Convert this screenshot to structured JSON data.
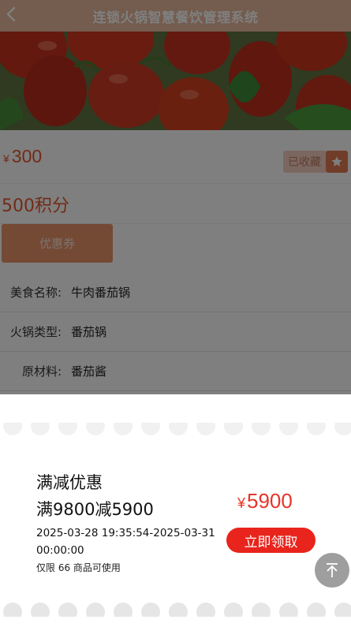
{
  "header": {
    "title": "连锁火锅智慧餐饮管理系统"
  },
  "product": {
    "currency": "¥",
    "price": "300",
    "favorite_label": "已收藏",
    "points": "500积分",
    "coupon_button": "优惠券",
    "details": [
      {
        "label": "美食名称:",
        "value": "牛肉番茄锅"
      },
      {
        "label": "火锅类型:",
        "value": "番茄锅"
      },
      {
        "label": "原材料:",
        "value": "番茄酱"
      }
    ]
  },
  "coupon": {
    "title": "满减优惠",
    "condition": "满9800减5900",
    "time_range": "2025-03-28 19:35:54-2025-03-31 00:00:00",
    "note": "仅限 66 商品可使用",
    "currency": "¥",
    "amount": "5900",
    "claim_button": "立即领取"
  },
  "colors": {
    "header": "#e8b89c",
    "accent": "#e4572e",
    "claim": "#e8241c"
  },
  "icons": {
    "back": "chevron-left-icon",
    "favorite": "star-icon",
    "top": "arrow-up-icon"
  }
}
